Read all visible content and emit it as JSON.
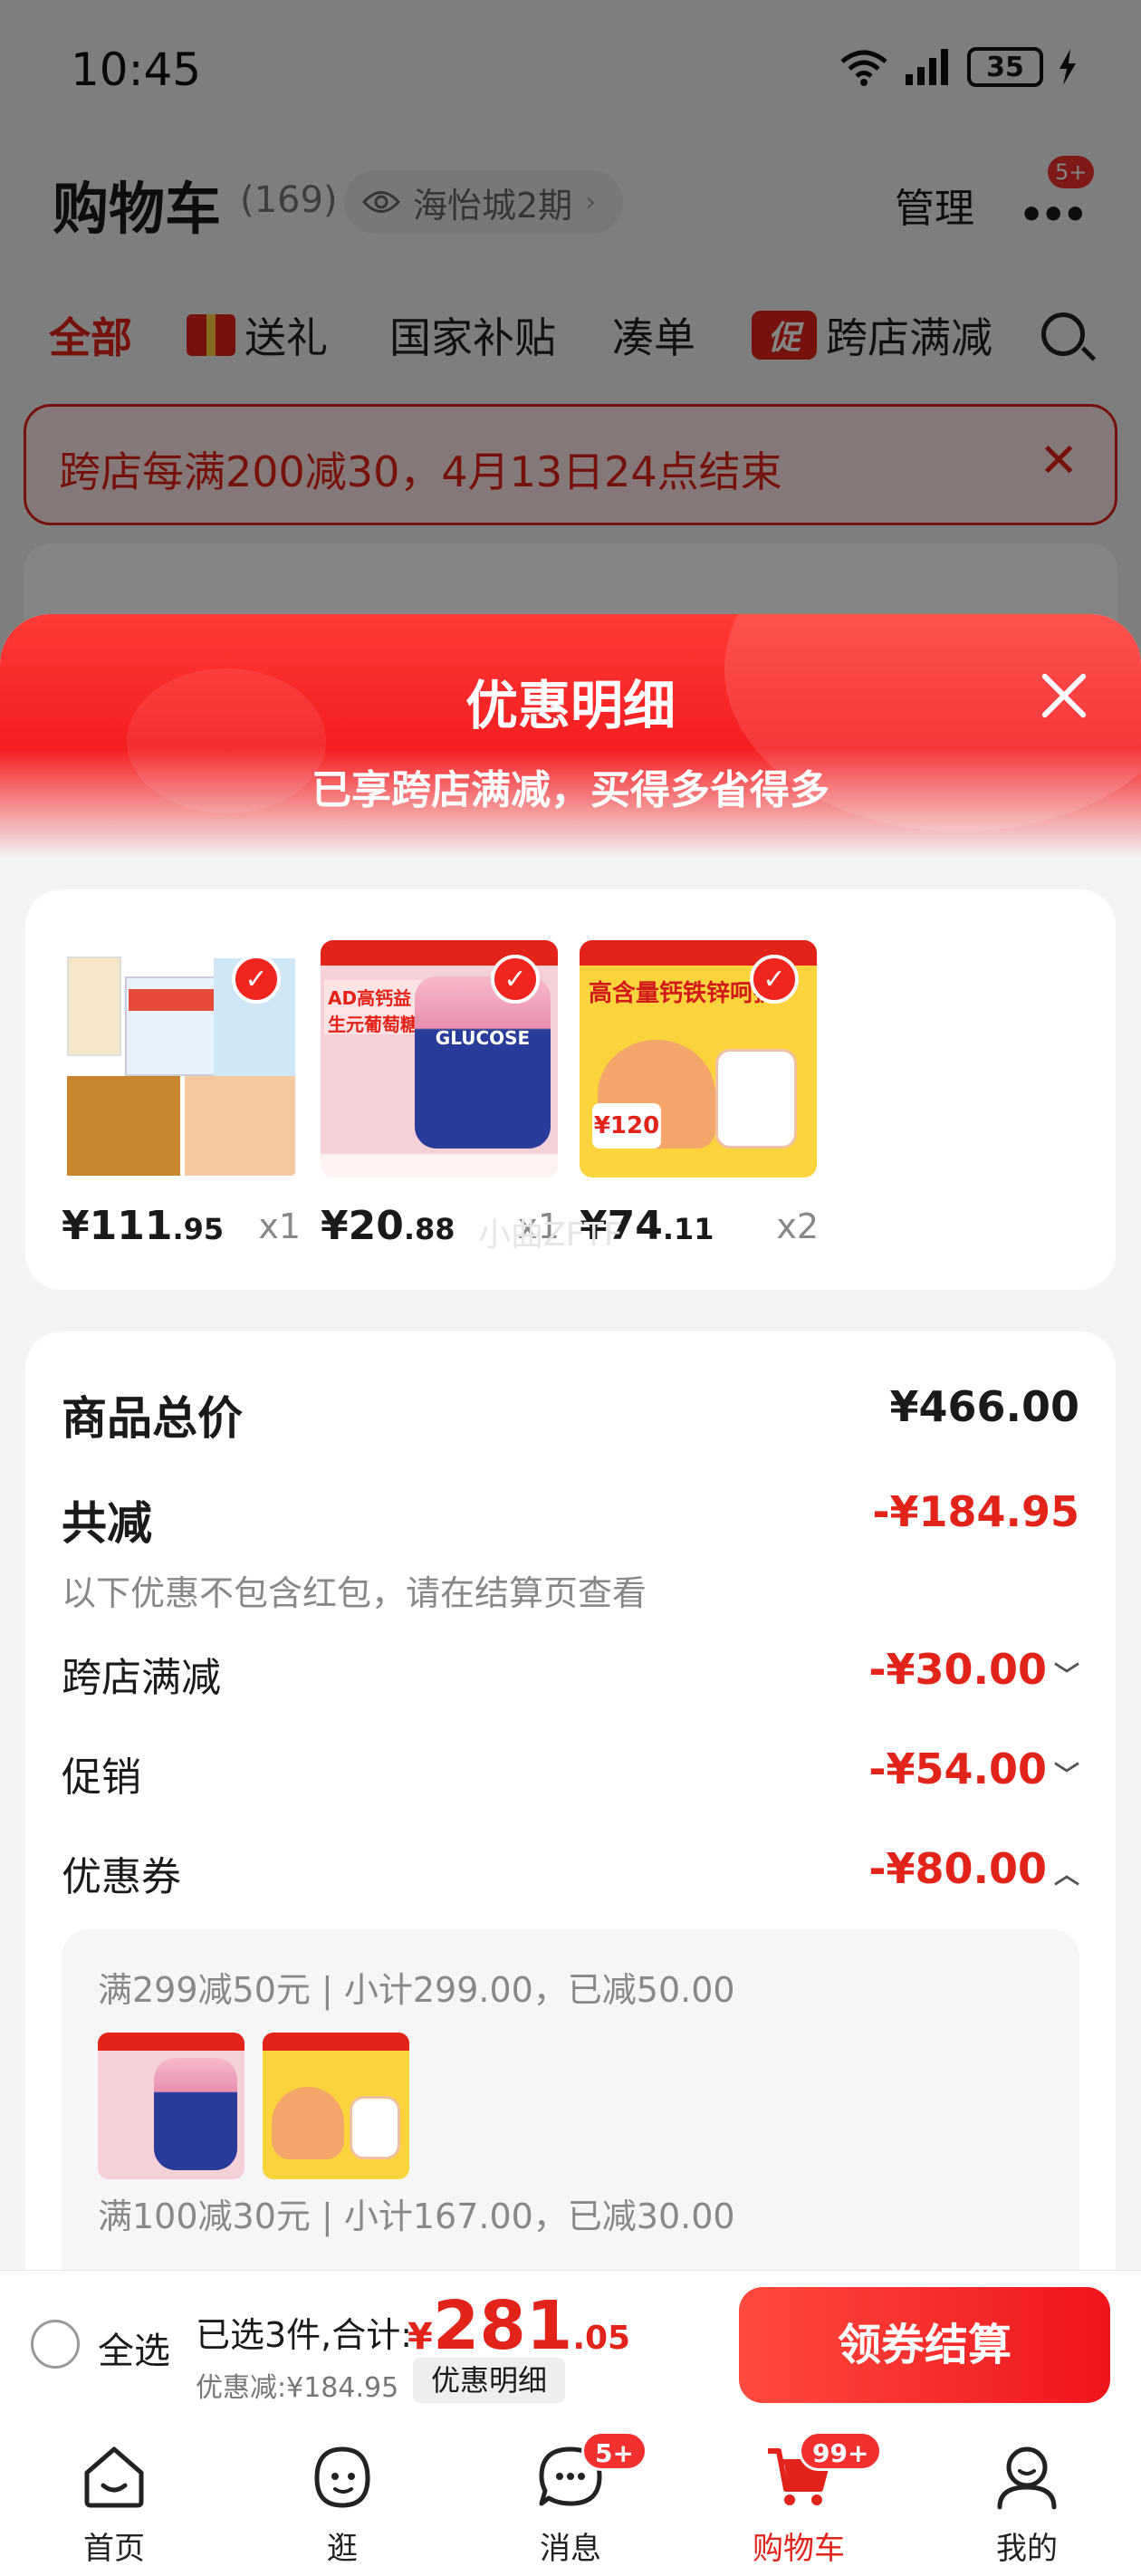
{
  "status_bar": {
    "time": "10:45",
    "battery": "35"
  },
  "header": {
    "title": "购物车",
    "count": "(169)",
    "location": "海怡城2期",
    "manage": "管理",
    "more_badge": "5+"
  },
  "tabs": [
    {
      "label": "全部"
    },
    {
      "label": "送礼"
    },
    {
      "label": "国家补贴"
    },
    {
      "label": "凑单"
    },
    {
      "label": "跨店满减",
      "tag": "促"
    }
  ],
  "banner": {
    "text": "跨店每满200减30，4月13日24点结束"
  },
  "sheet": {
    "title": "优惠明细",
    "subtitle": "已享跨店满减，买得多省得多"
  },
  "products": [
    {
      "price_int": "¥111",
      "price_dec": ".95",
      "qty": "x1"
    },
    {
      "price_int": "¥20",
      "price_dec": ".88",
      "qty": "x1",
      "thumb_text": "AD高钙益生元葡萄糖"
    },
    {
      "price_int": "¥74",
      "price_dec": ".11",
      "qty": "x2",
      "thumb_text": "高含量钙铁锌呵护",
      "chip": "¥120"
    }
  ],
  "watermark": "小曲ZFTF",
  "summary": {
    "total_label": "商品总价",
    "total_value": "¥466.00",
    "reduce_label": "共减",
    "reduce_value": "-¥184.95",
    "note": "以下优惠不包含红包，请在结算页查看",
    "items": [
      {
        "label": "跨店满减",
        "value": "-¥30.00",
        "caret": "﹀"
      },
      {
        "label": "促销",
        "value": "-¥54.00",
        "caret": "﹀"
      },
      {
        "label": "优惠券",
        "value": "-¥80.00",
        "caret": "︿"
      }
    ],
    "coupons": [
      {
        "text": "满299减50元 | 小计299.00，已减50.00"
      },
      {
        "text": "满100减30元 | 小计167.00，已减30.00"
      }
    ]
  },
  "checkout": {
    "select_all": "全选",
    "selected": "已选3件,合计:",
    "currency": "¥",
    "amount_int": "281",
    "amount_dec": ".05",
    "discount": "优惠减:¥184.95",
    "detail_chip": "优惠明细",
    "pay": "领券结算"
  },
  "nav": [
    {
      "label": "首页"
    },
    {
      "label": "逛"
    },
    {
      "label": "消息",
      "badge": "5+"
    },
    {
      "label": "购物车",
      "badge": "99+"
    },
    {
      "label": "我的"
    }
  ],
  "colors": {
    "accent": "#e2231a",
    "sheet_gradient_top": "#ff3a35"
  }
}
